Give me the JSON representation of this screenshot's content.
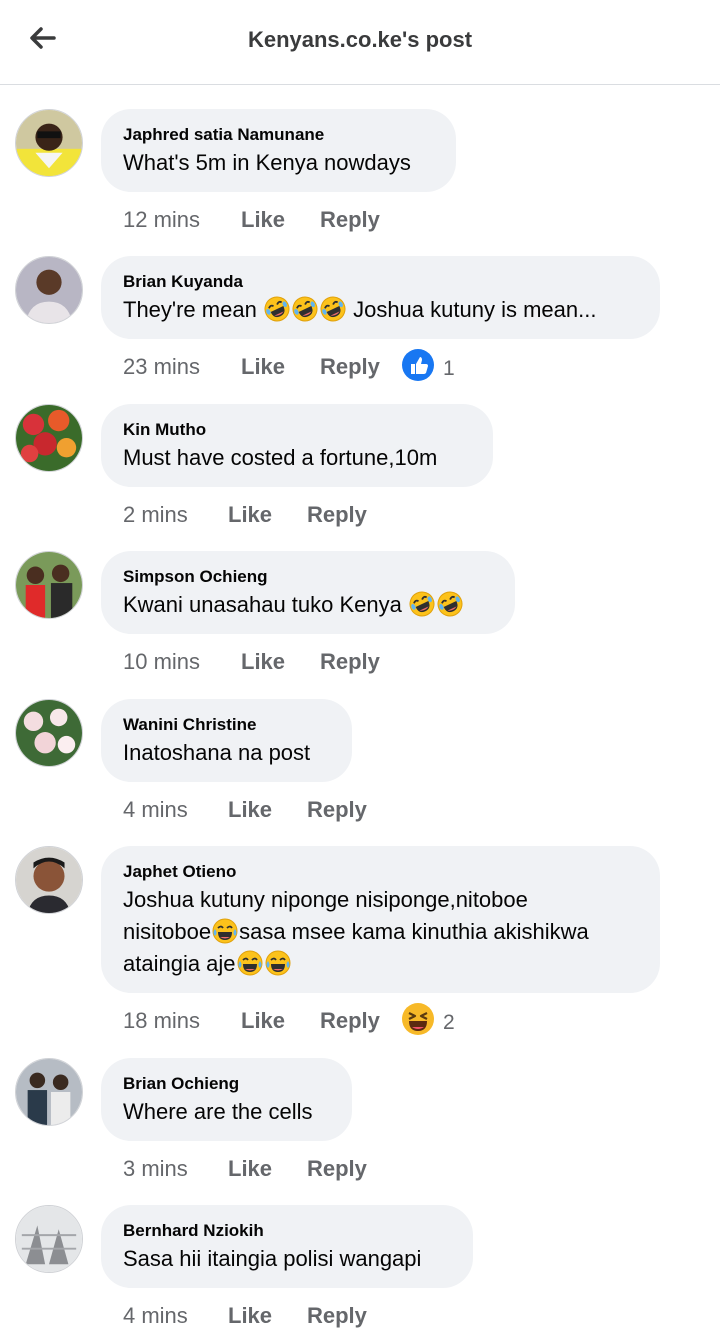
{
  "header": {
    "title": "Kenyans.co.ke's post",
    "back_icon": "arrow-left-icon"
  },
  "colors": {
    "bubble": "#f0f2f5",
    "meta_text": "#65676b",
    "like_blue": "#1877f2",
    "haha_yellow": "#f7b928"
  },
  "action_labels": {
    "like": "Like",
    "reply": "Reply"
  },
  "comments": [
    {
      "author": "Japhred satia Namunane",
      "text": "What's 5m in Kenya nowdays",
      "time": "12 mins"
    },
    {
      "author": "Brian Kuyanda",
      "text_before": "They're mean",
      "text_after": "Joshua kutuny is mean...",
      "emoji": "rolling-laughing-emoji",
      "time": "23 mins",
      "reaction": {
        "icon": "like-reaction-icon",
        "count": "1"
      }
    },
    {
      "author": "Kin Mutho",
      "text": "Must have costed a fortune,10m",
      "time": "2 mins"
    },
    {
      "author": "Simpson Ochieng",
      "text": "Kwani unasahau tuko Kenya",
      "emoji": "rolling-laughing-emoji",
      "time": "10 mins"
    },
    {
      "author": "Wanini Christine",
      "text": "Inatoshana na post",
      "time": "4 mins"
    },
    {
      "author": "Japhet Otieno",
      "line1": "Joshua kutuny niponge nisiponge,nitoboe",
      "line2_a": "nisitoboe",
      "line2_b": "sasa msee kama kinuthia akishikwa",
      "line3": "ataingia aje",
      "emoji": "tears-of-joy-emoji",
      "time": "18 mins",
      "reaction": {
        "icon": "haha-reaction-icon",
        "count": "2"
      }
    },
    {
      "author": "Brian Ochieng",
      "text": "Where are the cells",
      "time": "3 mins"
    },
    {
      "author": "Bernhard Nziokih",
      "text": "Sasa hii itaingia polisi wangapi",
      "time": "4 mins"
    }
  ]
}
